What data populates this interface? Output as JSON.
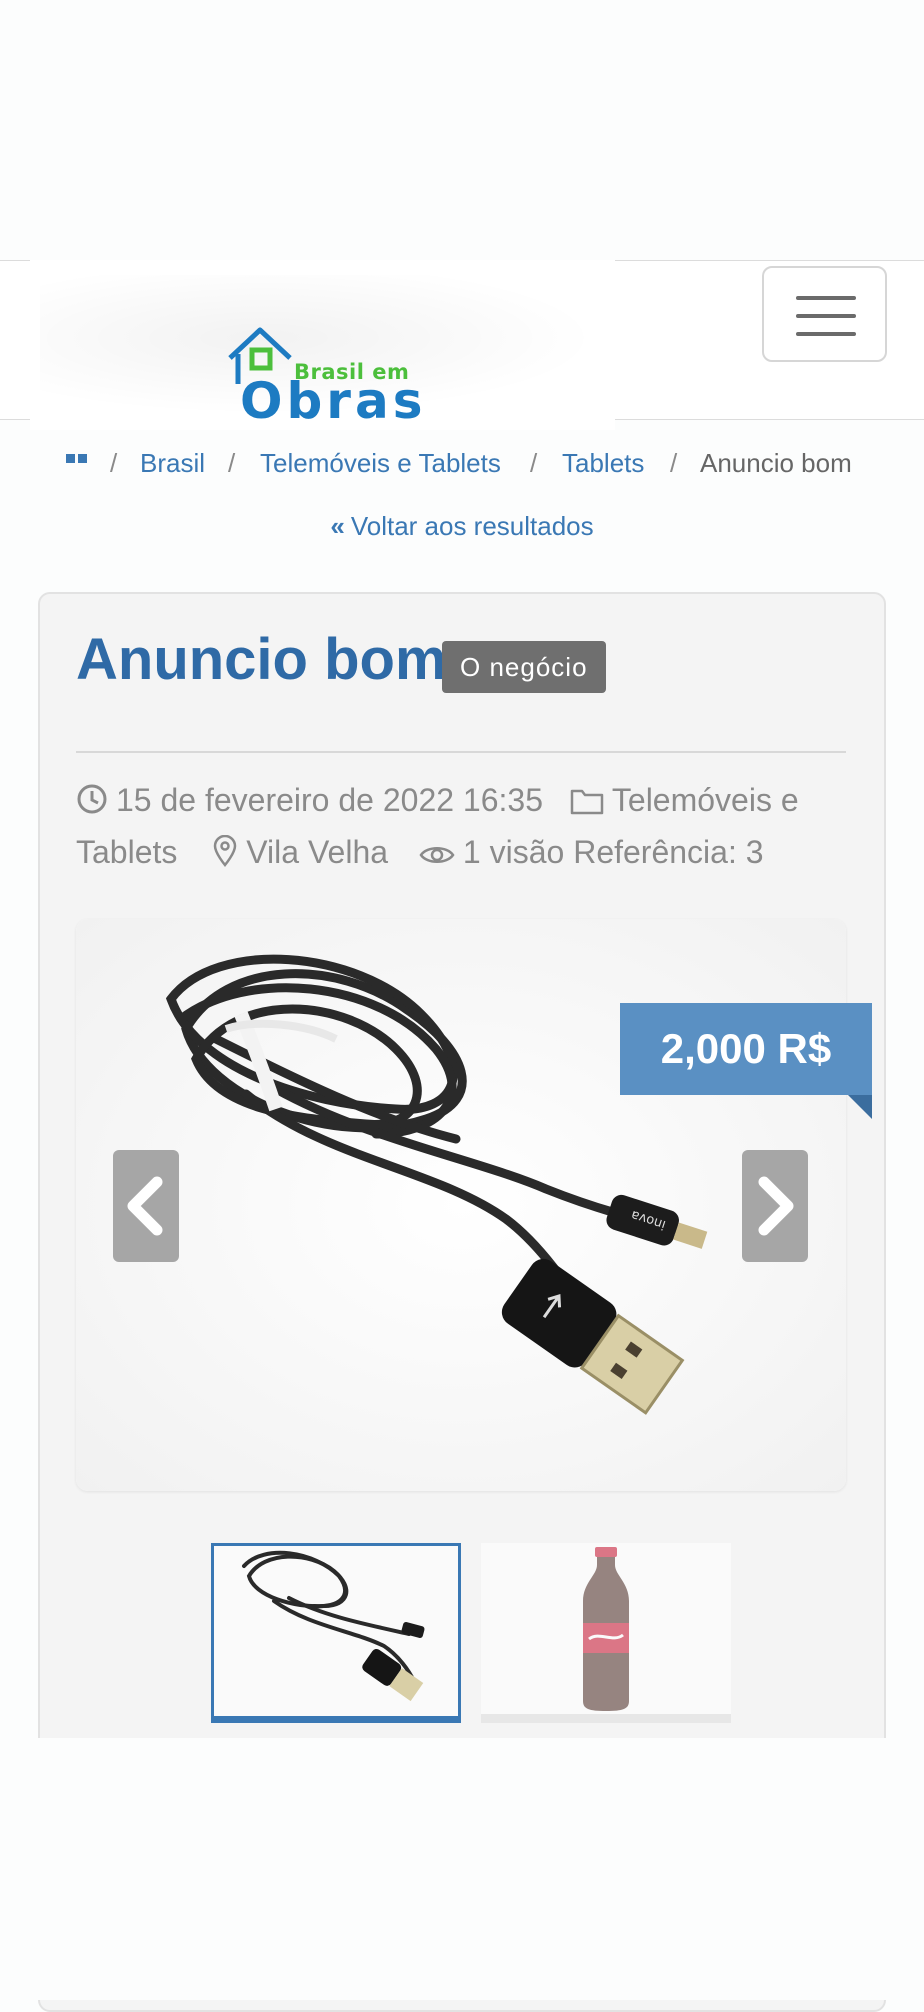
{
  "header": {
    "logo_line1": "Brasil em",
    "logo_line2": "Obras"
  },
  "breadcrumb": {
    "items": [
      "Brasil",
      "Telemóveis e Tablets",
      "Tablets"
    ],
    "current": "Anuncio bom",
    "separator": "/"
  },
  "back_link": {
    "label": "Voltar aos resultados"
  },
  "listing": {
    "title": "Anuncio bom",
    "badge": "O negócio",
    "date": "15 de fevereiro de 2022 16:35",
    "category_part1": "Telemóveis e",
    "category_part2": "Tablets",
    "location": "Vila Velha",
    "views": "1 visão",
    "reference": "Referência: 3",
    "price": "2,000 R$"
  },
  "colors": {
    "brand_blue": "#2f6aa6",
    "link_blue": "#3a78b4",
    "price_blue": "#5a90c3",
    "badge_gray": "#6f6f6f",
    "logo_green": "#4cbf3c"
  },
  "icons": [
    "home-icon",
    "double-chevron-left-icon",
    "clock-icon",
    "folder-icon",
    "map-pin-icon",
    "eye-icon",
    "chevron-left-icon",
    "chevron-right-icon",
    "hamburger-icon"
  ]
}
